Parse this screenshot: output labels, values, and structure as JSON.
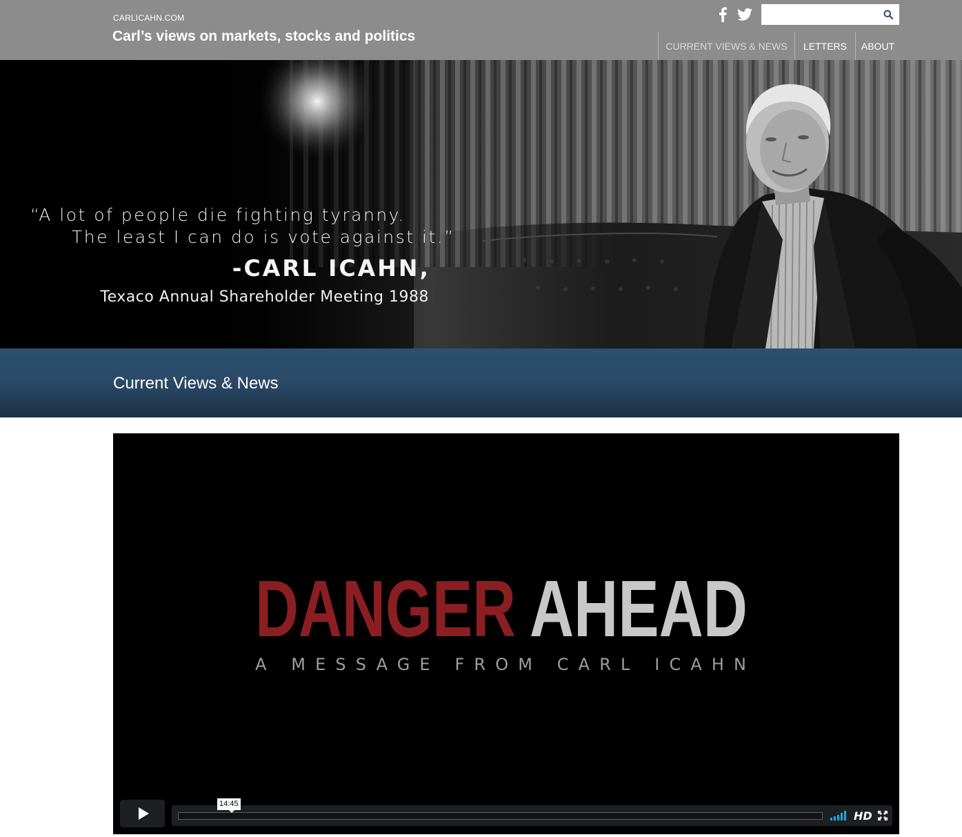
{
  "header": {
    "site_url": "CARLICAHN.COM",
    "tagline": "Carl’s views on markets, stocks and politics",
    "search": {
      "placeholder": "",
      "value": ""
    },
    "social_icons": [
      "facebook-icon",
      "twitter-icon"
    ],
    "nav": [
      {
        "label": "CURRENT VIEWS & NEWS",
        "active": true
      },
      {
        "label": "LETTERS",
        "active": false
      },
      {
        "label": "ABOUT",
        "active": false
      }
    ]
  },
  "hero": {
    "quote_line1": "“A lot of people die fighting tyranny.",
    "quote_line2": "The least I can do is vote against it.”",
    "author": "-CARL ICAHN,",
    "event": "Texaco Annual Shareholder Meeting 1988"
  },
  "section": {
    "title": "Current Views & News"
  },
  "video": {
    "title_red": "DANGER",
    "title_gray": "AHEAD",
    "subtitle": "A MESSAGE FROM CARL ICAHN",
    "duration": "14:45",
    "quality": "HD",
    "progress": 0
  },
  "colors": {
    "header_bg": "#8c8c8c",
    "section_bar": "#2a4966",
    "title_red": "#8b1e22",
    "title_gray": "#c8c8c8",
    "volume_accent": "#1aa7ec"
  }
}
